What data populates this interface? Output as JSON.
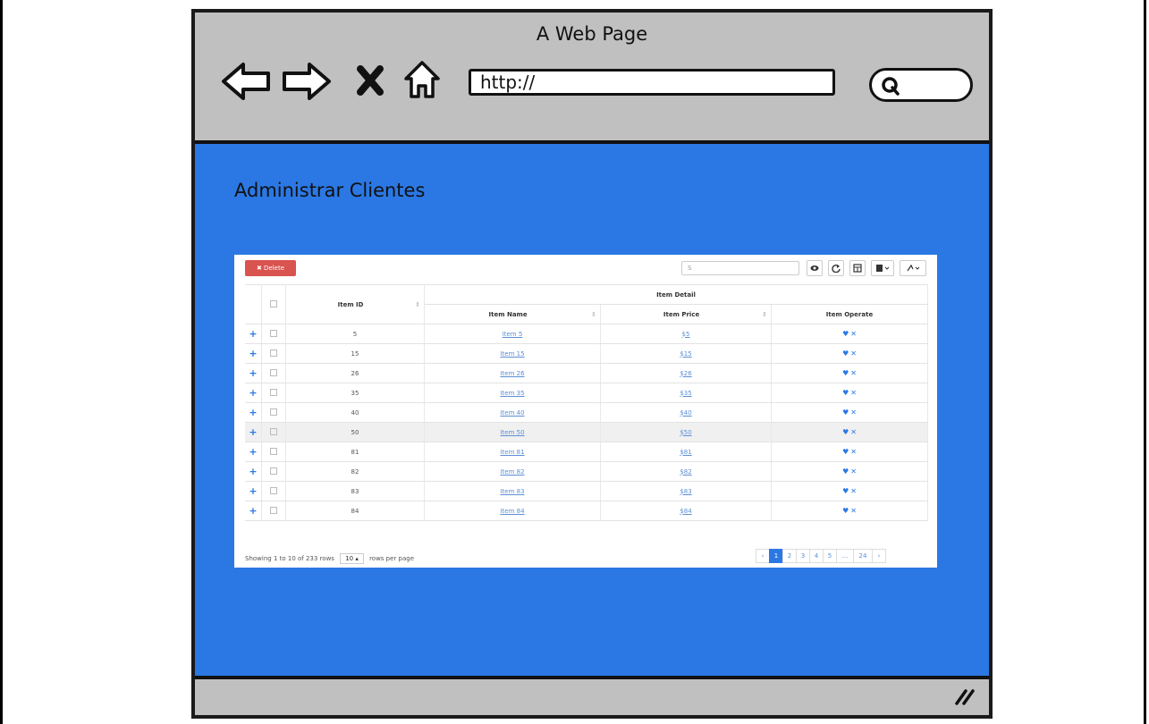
{
  "browser": {
    "title": "A Web Page",
    "url": "http://"
  },
  "page": {
    "title": "Administrar Clientes"
  },
  "toolbar": {
    "delete_label": "✖ Delete",
    "search_placeholder": "S"
  },
  "table": {
    "group_header": "Item Detail",
    "headers": {
      "id": "Item ID",
      "name": "Item Name",
      "price": "Item Price",
      "operate": "Item Operate"
    },
    "rows": [
      {
        "id": "5",
        "name": "Item 5",
        "price": "$5"
      },
      {
        "id": "15",
        "name": "Item 15",
        "price": "$15"
      },
      {
        "id": "26",
        "name": "Item 26",
        "price": "$26"
      },
      {
        "id": "35",
        "name": "Item 35",
        "price": "$35"
      },
      {
        "id": "40",
        "name": "Item 40",
        "price": "$40"
      },
      {
        "id": "50",
        "name": "Item 50",
        "price": "$50"
      },
      {
        "id": "81",
        "name": "Item 81",
        "price": "$81"
      },
      {
        "id": "82",
        "name": "Item 82",
        "price": "$82"
      },
      {
        "id": "83",
        "name": "Item 83",
        "price": "$83"
      },
      {
        "id": "84",
        "name": "Item 84",
        "price": "$84"
      }
    ],
    "highlighted_row_index": 5
  },
  "footer": {
    "showing": "Showing 1 to 10 of 233 rows",
    "page_size": "10 ▴",
    "per_page": "rows per page"
  },
  "pagination": {
    "prev": "‹",
    "pages": [
      "1",
      "2",
      "3",
      "4",
      "5"
    ],
    "ellipsis": "...",
    "last": "24",
    "next": "›",
    "active": "1"
  },
  "colors": {
    "content_bg": "#2b78e4",
    "chrome_bg": "#c0c0c0",
    "delete_btn": "#d9534f",
    "link": "#5b8fd6"
  }
}
